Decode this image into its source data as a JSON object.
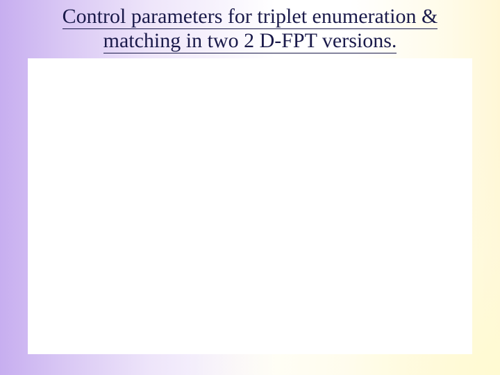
{
  "title_line1": "Control parameters for triplet enumeration &",
  "title_line2": "matching in two 2 D-FPT versions."
}
